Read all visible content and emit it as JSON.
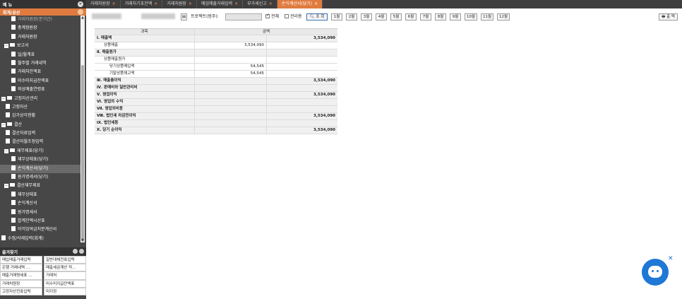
{
  "sidebar": {
    "title": "메 뉴",
    "section": "회계/공산",
    "tree": [
      {
        "label": "거래처원장(분기간)",
        "type": "leaf",
        "indent": 16,
        "dim": true
      },
      {
        "label": "총계정원장",
        "type": "leaf",
        "indent": 16
      },
      {
        "label": "거래처원장",
        "type": "leaf",
        "indent": 16
      },
      {
        "label": "보고서",
        "type": "folder",
        "indent": 6
      },
      {
        "label": "일/월계표",
        "type": "leaf",
        "indent": 16
      },
      {
        "label": "월주별 거래내역",
        "type": "leaf",
        "indent": 16
      },
      {
        "label": "거래처잔액표",
        "type": "leaf",
        "indent": 16
      },
      {
        "label": "미수미지급잔액표",
        "type": "leaf",
        "indent": 16
      },
      {
        "label": "외상매출연령표",
        "type": "leaf",
        "indent": 16
      },
      {
        "label": "고정자산관리",
        "type": "folder",
        "indent": 2
      },
      {
        "label": "고정자산",
        "type": "leaf",
        "indent": 8
      },
      {
        "label": "감가상각현황",
        "type": "leaf",
        "indent": 8
      },
      {
        "label": "결산",
        "type": "folder",
        "indent": 2
      },
      {
        "label": "결산자료입력",
        "type": "leaf",
        "indent": 8
      },
      {
        "label": "결산미월조정입력",
        "type": "leaf",
        "indent": 8
      },
      {
        "label": "재무제표(당기)",
        "type": "folder",
        "indent": 6
      },
      {
        "label": "재무상태표(당기)",
        "type": "leaf",
        "indent": 16
      },
      {
        "label": "손익계산서(당기)",
        "type": "leaf",
        "indent": 16,
        "selected": true
      },
      {
        "label": "원가명세서(당기)",
        "type": "leaf",
        "indent": 16
      },
      {
        "label": "결산재무제표",
        "type": "folder",
        "indent": 6
      },
      {
        "label": "재무상태표",
        "type": "leaf",
        "indent": 16
      },
      {
        "label": "손익계산서",
        "type": "leaf",
        "indent": 16
      },
      {
        "label": "원가명세서",
        "type": "leaf",
        "indent": 16
      },
      {
        "label": "합계잔액시산표",
        "type": "leaf",
        "indent": 16
      },
      {
        "label": "이익잉여금처분계산서",
        "type": "leaf",
        "indent": 16
      },
      {
        "label": "수정/삭제입력(회계)",
        "type": "leaf",
        "indent": 2
      }
    ],
    "favorites_title": "즐겨찾기",
    "favorites": [
      "매입매출거래입력",
      "일반대체전표입력",
      "은행 거래내역 ...",
      "매출세금계산 작...",
      "매출거래명세표 ...",
      "거래처",
      "거래처원장",
      "미수미지급잔액표",
      "고정자산전표입력",
      "미지정"
    ]
  },
  "tabs": [
    {
      "label": "거래처원장",
      "active": false
    },
    {
      "label": "거래처기초잔액",
      "active": false
    },
    {
      "label": "거래처원장",
      "active": false
    },
    {
      "label": "매입매출거래입력",
      "active": false
    },
    {
      "label": "부가세신고",
      "active": false
    },
    {
      "label": "손익계산서(당기)",
      "active": true
    }
  ],
  "toolbar": {
    "project_label": "프로젝트(범주):",
    "all_label": "전체",
    "manager_label": "관리용",
    "search_label": "조 회",
    "months": [
      "1월",
      "2월",
      "3월",
      "4월",
      "5월",
      "6월",
      "7월",
      "8월",
      "9월",
      "10월",
      "11월",
      "12월"
    ],
    "print_label": "출 력"
  },
  "table": {
    "headers": [
      "과목",
      "금액"
    ],
    "rows": [
      {
        "label": "Ⅰ. 매출액",
        "sub": "",
        "total": "3,534,090",
        "bold": true,
        "alt": true,
        "indent": 0
      },
      {
        "label": "상품매출",
        "sub": "3,534,090",
        "total": "",
        "bold": false,
        "alt": false,
        "indent": 10
      },
      {
        "label": "Ⅱ. 매출원가",
        "sub": "",
        "total": "",
        "bold": true,
        "alt": true,
        "indent": 0
      },
      {
        "label": "상품매출원가",
        "sub": "",
        "total": "",
        "bold": false,
        "alt": false,
        "indent": 10
      },
      {
        "label": "당기상품매입액",
        "sub": "54,545",
        "total": "",
        "bold": false,
        "alt": false,
        "indent": 18
      },
      {
        "label": "기말상품재고액",
        "sub": "54,545",
        "total": "",
        "bold": false,
        "alt": false,
        "indent": 18
      },
      {
        "label": "Ⅲ. 매출총이익",
        "sub": "",
        "total": "3,534,090",
        "bold": true,
        "alt": true,
        "indent": 0
      },
      {
        "label": "Ⅳ. 판매비와 일반관리비",
        "sub": "",
        "total": "",
        "bold": true,
        "alt": true,
        "indent": 0
      },
      {
        "label": "Ⅴ. 영업이익",
        "sub": "",
        "total": "3,534,090",
        "bold": true,
        "alt": true,
        "indent": 0
      },
      {
        "label": "Ⅵ. 영업외 수익",
        "sub": "",
        "total": "",
        "bold": true,
        "alt": true,
        "indent": 0
      },
      {
        "label": "Ⅶ. 영업외비용",
        "sub": "",
        "total": "",
        "bold": true,
        "alt": true,
        "indent": 0
      },
      {
        "label": "Ⅷ. 법인세 차감전이익",
        "sub": "",
        "total": "3,534,090",
        "bold": true,
        "alt": true,
        "indent": 0
      },
      {
        "label": "Ⅸ. 법인세등",
        "sub": "",
        "total": "",
        "bold": true,
        "alt": true,
        "indent": 0
      },
      {
        "label": "Ⅹ. 당기 순이익",
        "sub": "",
        "total": "3,534,090",
        "bold": true,
        "alt": true,
        "indent": 0
      }
    ]
  },
  "colors": {
    "accent": "#e07b3f",
    "sidebar_bg": "#474747",
    "chatbot": "#1e78d6"
  },
  "icons": {
    "search": "magnifier-icon",
    "print": "printer-icon",
    "chatbot": "chatbot-bear-icon"
  }
}
